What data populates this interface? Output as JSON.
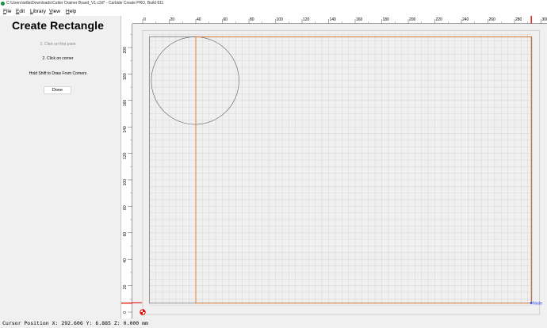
{
  "window": {
    "title": "C:\\Users\\willa\\Downloads\\Cutter Drainer Board_V1.c2d* - Carbide Create PRO, Build 811"
  },
  "menu": {
    "items": [
      "File",
      "Edit",
      "Library",
      "View",
      "Help"
    ]
  },
  "panel": {
    "title": "Create Rectangle",
    "step1": "1. Click on first point",
    "step2": "2. Click on corner",
    "hint": "Hold Shift to Draw From Corners",
    "done_label": "Done"
  },
  "rulers": {
    "top_ticks": [
      "0",
      "20",
      "40",
      "60",
      "80",
      "100",
      "120",
      "140",
      "160",
      "180",
      "200",
      "220",
      "240",
      "260",
      "280",
      "300"
    ],
    "left_ticks": [
      "0",
      "20",
      "40",
      "60",
      "80",
      "100",
      "120",
      "140",
      "160",
      "180",
      "200"
    ]
  },
  "canvas": {
    "node_label": "Node",
    "colors": {
      "grid": "#d6d6d6",
      "stock": "#7f7f7f",
      "shape": "#5a5a5a",
      "rectangle": "#e07a30",
      "marker": "#e00000",
      "origin": "#e00000",
      "node": "#1a3cff"
    }
  },
  "status": {
    "text": "Cursor Position X: 292.606 Y: 6.885 Z: 0.000 mm"
  }
}
